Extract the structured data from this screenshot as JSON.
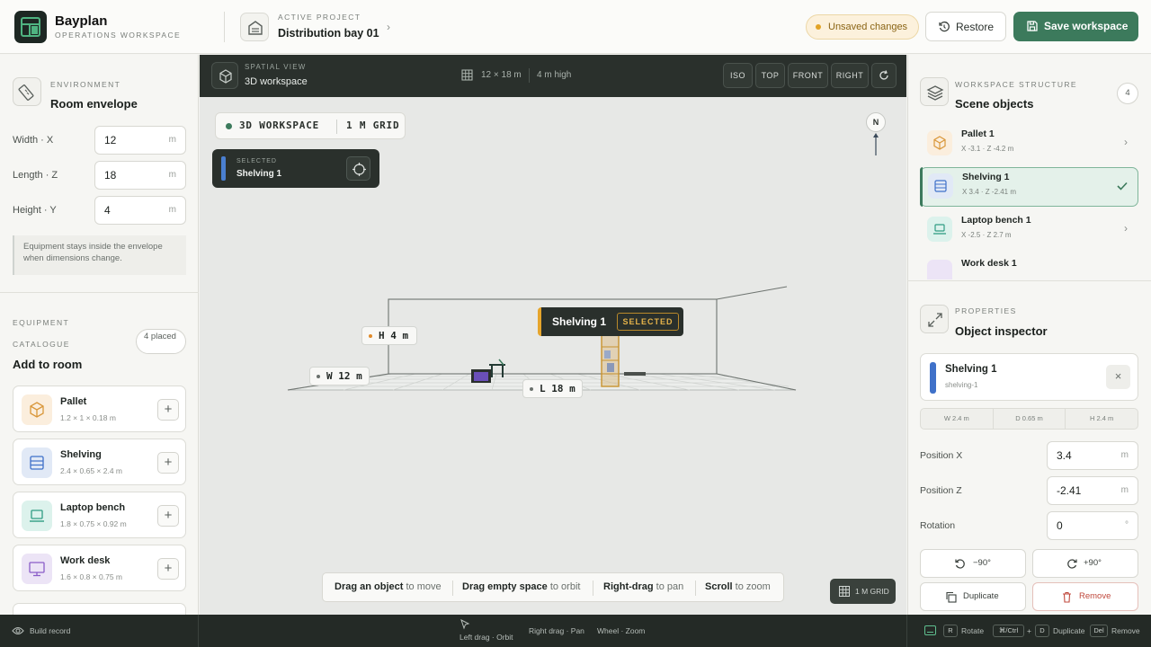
{
  "app": {
    "name": "Bayplan",
    "subtitle": "OPERATIONS WORKSPACE"
  },
  "project": {
    "label": "ACTIVE PROJECT",
    "name": "Distribution bay 01"
  },
  "header": {
    "unsaved": "Unsaved changes",
    "restore": "Restore",
    "save": "Save workspace"
  },
  "environment": {
    "label": "ENVIRONMENT",
    "title": "Room envelope",
    "fields": [
      {
        "label": "Width · X",
        "value": "12",
        "unit": "m"
      },
      {
        "label": "Length · Z",
        "value": "18",
        "unit": "m"
      },
      {
        "label": "Height · Y",
        "value": "4",
        "unit": "m"
      }
    ],
    "note": "Equipment stays inside the envelope when dimensions change."
  },
  "equipment": {
    "label1": "EQUIPMENT",
    "label2": "CATALOGUE",
    "title": "Add to room",
    "count": "4 placed",
    "items": [
      {
        "name": "Pallet",
        "dims": "1.2 × 1 × 0.18 m",
        "icon": "box-icon",
        "color": "#fbeedd",
        "stroke": "#d9973a"
      },
      {
        "name": "Shelving",
        "dims": "2.4 × 0.65 × 2.4 m",
        "icon": "shelving-icon",
        "color": "#e1e9f6",
        "stroke": "#3f71c9"
      },
      {
        "name": "Laptop bench",
        "dims": "1.8 × 0.75 × 0.92 m",
        "icon": "laptop-icon",
        "color": "#dcf2ec",
        "stroke": "#2f9c83"
      },
      {
        "name": "Work desk",
        "dims": "1.6 × 0.8 × 0.75 m",
        "icon": "monitor-icon",
        "color": "#ece4f6",
        "stroke": "#8a5cc8"
      }
    ]
  },
  "viewport": {
    "label": "SPATIAL VIEW",
    "title": "3D workspace",
    "size": "12 × 18 m",
    "height": "4 m high",
    "views": [
      "ISO",
      "TOP",
      "FRONT",
      "RIGHT"
    ],
    "mode": "3D WORKSPACE",
    "grid": "1 M GRID",
    "selected_label": "SELECTED",
    "selected_name": "Shelving 1",
    "compass": "N",
    "tag_h": "H 4 m",
    "tag_w": "W 12 m",
    "tag_l": "L 18 m",
    "shelf_name": "Shelving 1",
    "shelf_badge": "SELECTED",
    "hint": [
      {
        "b": "Drag an object",
        "t": "to move"
      },
      {
        "b": "Drag empty space",
        "t": "to orbit"
      },
      {
        "b": "Right-drag",
        "t": "to pan"
      },
      {
        "b": "Scroll",
        "t": "to zoom"
      }
    ],
    "grid_badge": "1 M GRID"
  },
  "structure": {
    "label": "WORKSPACE STRUCTURE",
    "title": "Scene objects",
    "count": "4",
    "objects": [
      {
        "name": "Pallet 1",
        "pos": "X -3.1 · Z -4.2 m",
        "color": "#fbeedd",
        "stroke": "#d9973a"
      },
      {
        "name": "Shelving 1",
        "pos": "X 3.4 · Z -2.41 m",
        "color": "#e1e9f6",
        "stroke": "#3f71c9"
      },
      {
        "name": "Laptop bench 1",
        "pos": "X -2.5 · Z 2.7 m",
        "color": "#dcf2ec",
        "stroke": "#2f9c83"
      },
      {
        "name": "Work desk 1",
        "pos": "",
        "color": "#ece4f6",
        "stroke": "#8a5cc8"
      }
    ]
  },
  "inspector": {
    "label": "PROPERTIES",
    "title": "Object inspector",
    "name": "Shelving 1",
    "id": "shelving-1",
    "dims": [
      "W 2.4 m",
      "D 0.65 m",
      "H 2.4 m"
    ],
    "fields": [
      {
        "label": "Position X",
        "value": "3.4",
        "unit": "m"
      },
      {
        "label": "Position Z",
        "value": "-2.41",
        "unit": "m"
      },
      {
        "label": "Rotation",
        "value": "0",
        "unit": "°"
      }
    ],
    "rot_left": "−90°",
    "rot_right": "+90°",
    "duplicate": "Duplicate",
    "remove": "Remove"
  },
  "footer": {
    "build": "Build record",
    "center": [
      "Left drag · Orbit",
      "Right drag · Pan",
      "Wheel · Zoom"
    ],
    "keys": {
      "r": "R",
      "rotate": "Rotate",
      "ctrl": "⌘/Ctrl",
      "plus": "+",
      "d": "D",
      "duplicate": "Duplicate",
      "del": "Del",
      "remove": "Remove"
    }
  }
}
